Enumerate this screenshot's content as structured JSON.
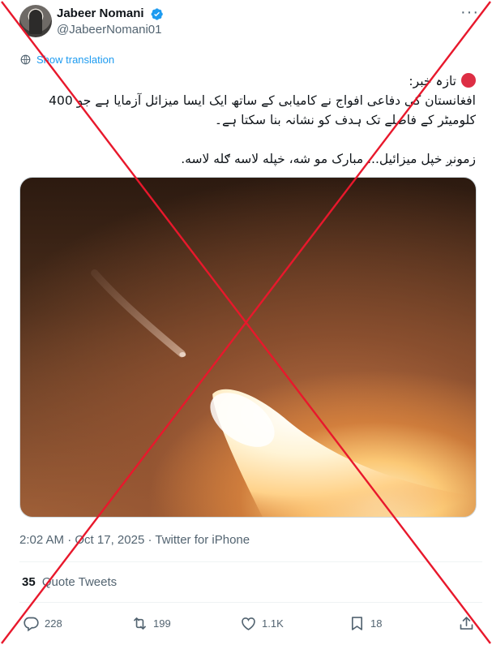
{
  "author": {
    "display_name": "Jabeer Nomani",
    "handle": "@JabeerNomani01",
    "verified_badge_icon": "verified-badge-icon",
    "more_icon": "more-options-icon"
  },
  "translate": {
    "label": "Show translation",
    "icon": "translate-globe-icon"
  },
  "tweet": {
    "lines": [
      "تازہ خبر:",
      "افغانستان کی دفاعی افواج نے کامیابی کے ساتھ ایک ایسا میزائل آزمایا ہے جو 400",
      "کلومیٹر کے فاصلے تک ہدف کو نشانہ بنا سکتا ہے۔",
      "زمونږ خپل میزائیل... مبارک مو شه، خپله لاسه ګله لاسه."
    ],
    "red_dot_color": "#dd2e44"
  },
  "media": {
    "type": "video-still",
    "subject": "missile launch at night"
  },
  "meta": {
    "time": "2:02 AM",
    "separator": "·",
    "date": "Oct 17, 2025",
    "source": "Twitter for iPhone"
  },
  "quotes": {
    "count": "35",
    "label": "Quote Tweets"
  },
  "actions": {
    "reply": {
      "icon": "reply-icon",
      "count": "228"
    },
    "retweet": {
      "icon": "retweet-icon",
      "count": "199"
    },
    "like": {
      "icon": "heart-icon",
      "count": "1.1K"
    },
    "bookmark": {
      "icon": "bookmark-icon",
      "count": "18"
    },
    "share": {
      "icon": "share-icon"
    }
  },
  "overlay": {
    "cross_color": "#e8182c"
  }
}
